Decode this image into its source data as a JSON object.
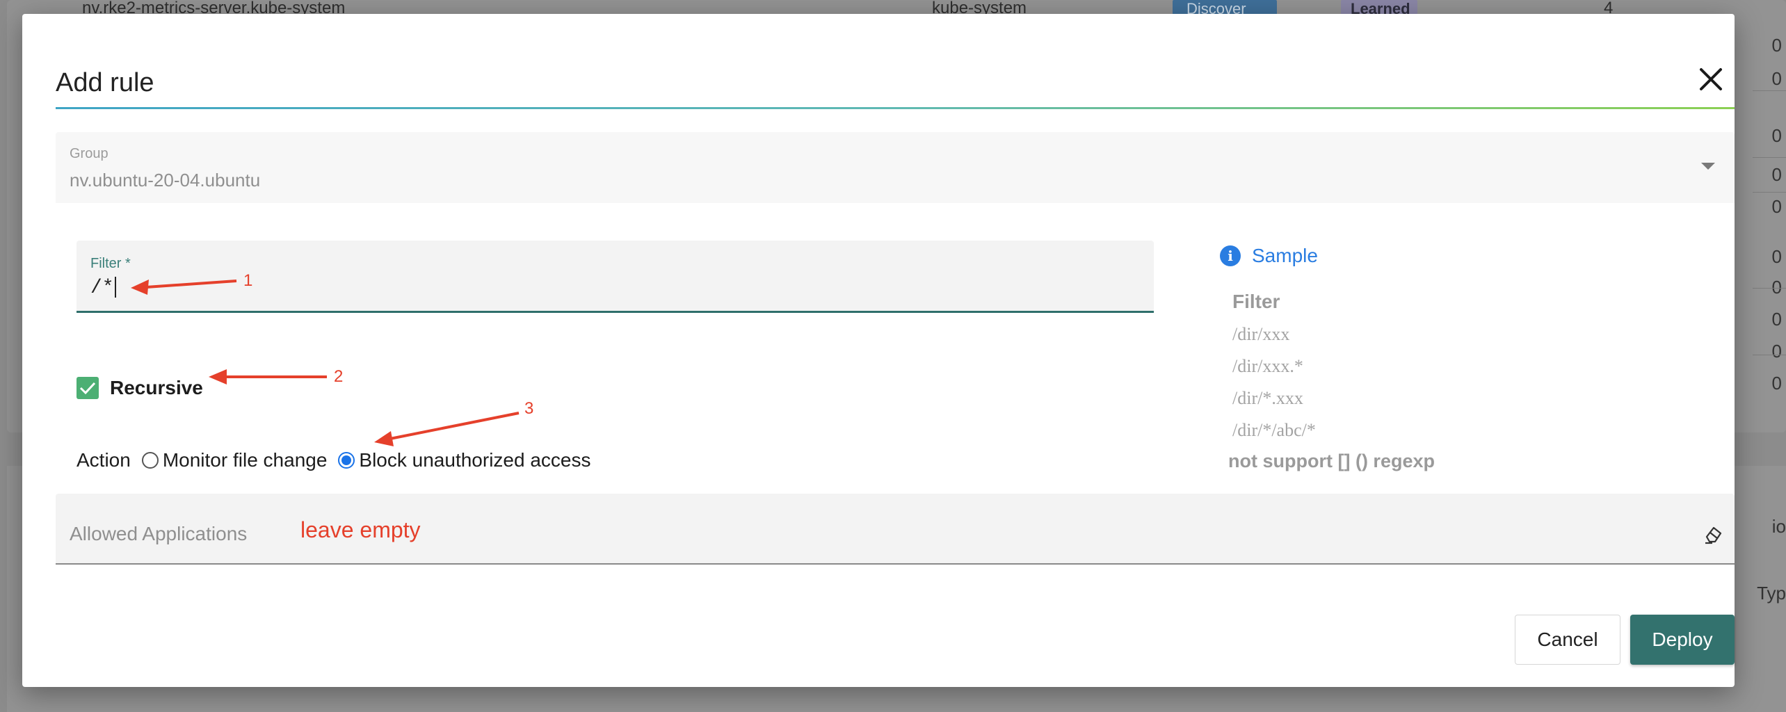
{
  "background": {
    "row_name": "nv.rke2-metrics-server.kube-system",
    "row_namespace": "kube-system",
    "row_mode": "Discover",
    "row_type": "Learned",
    "row_count": "4",
    "right_numbers": [
      "0",
      "0",
      "0",
      "0",
      "0",
      "0",
      "0",
      "0",
      "0",
      "0",
      "0"
    ],
    "right_texts": [
      "io",
      "Typ"
    ]
  },
  "modal": {
    "title": "Add rule",
    "close_icon": "close-icon"
  },
  "group": {
    "label": "Group",
    "value": "nv.ubuntu-20-04.ubuntu",
    "icon": "chevron-down-icon"
  },
  "filter": {
    "label": "Filter *",
    "value": "/*"
  },
  "recursive": {
    "label": "Recursive",
    "checked": true
  },
  "action": {
    "label": "Action",
    "options": [
      {
        "label": "Monitor file change",
        "selected": false
      },
      {
        "label": "Block unauthorized access",
        "selected": true
      }
    ]
  },
  "sample": {
    "icon": "info-icon",
    "title": "Sample",
    "filter_heading": "Filter",
    "items": [
      "/dir/xxx",
      "/dir/xxx.*",
      "/dir/*.xxx",
      "/dir/*/abc/*"
    ],
    "note": "not support [] () regexp"
  },
  "allowed_apps": {
    "label": "Allowed Applications",
    "icon": "eraser-icon"
  },
  "buttons": {
    "cancel": "Cancel",
    "deploy": "Deploy"
  },
  "annotations": {
    "one": "1",
    "two": "2",
    "three": "3",
    "leave_empty": "leave empty"
  },
  "colors": {
    "primary": "#33726e",
    "accent_blue": "#2a7de1",
    "checkbox_green": "#4caf73",
    "annotation_red": "#e5402b"
  }
}
